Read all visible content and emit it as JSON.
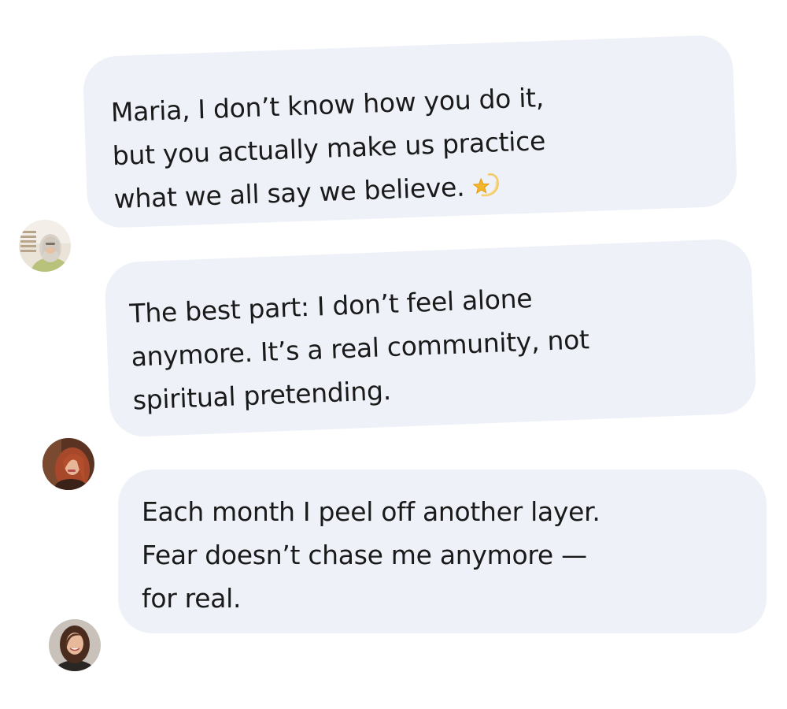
{
  "messages": [
    {
      "lines": [
        "Maria, I don’t know how you do it,",
        "but you actually make us practice",
        "what we all say we believe."
      ],
      "emoji": "shooting-star-icon"
    },
    {
      "lines": [
        "The best part: I don’t feel alone",
        "anymore. It’s a real community, not",
        "spiritual pretending."
      ]
    },
    {
      "lines": [
        "Each month I peel off another layer.",
        "Fear doesn’t chase me anymore —",
        "for real."
      ]
    }
  ],
  "colors": {
    "bubble": "#eef1f8",
    "text": "#1a1a1a",
    "page_background": "#ffffff",
    "emoji_star": "#f5b52a"
  }
}
